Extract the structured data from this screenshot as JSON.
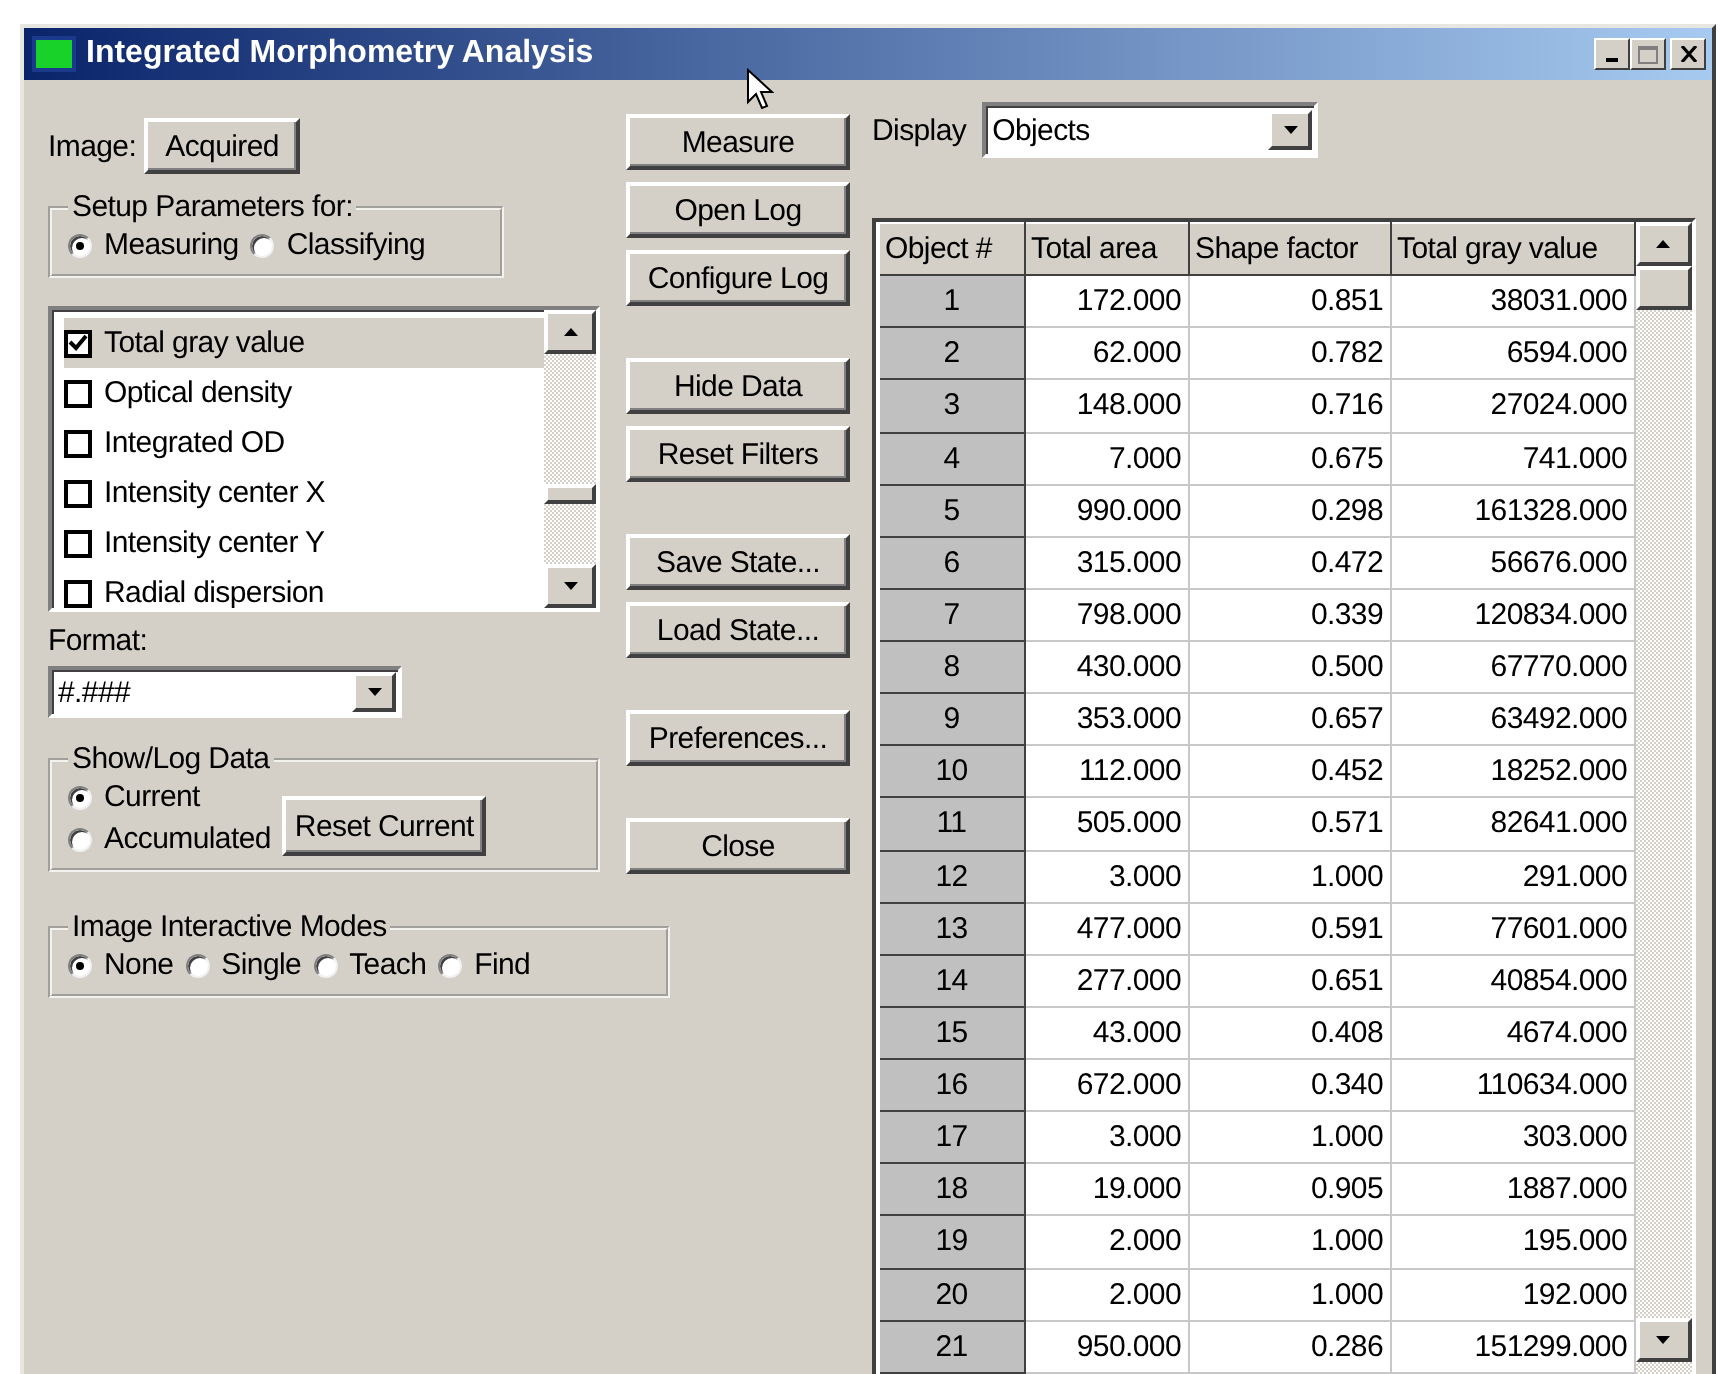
{
  "window": {
    "title": "Integrated Morphometry Analysis"
  },
  "image": {
    "label": "Image:",
    "button": "Acquired"
  },
  "setup_group": {
    "title": "Setup Parameters for:",
    "options": [
      {
        "label": "Measuring",
        "selected": true
      },
      {
        "label": "Classifying",
        "selected": false
      }
    ]
  },
  "parameters": [
    {
      "label": "Total gray value",
      "checked": true,
      "selected": true
    },
    {
      "label": "Optical density",
      "checked": false,
      "selected": false
    },
    {
      "label": "Integrated OD",
      "checked": false,
      "selected": false
    },
    {
      "label": "Intensity center X",
      "checked": false,
      "selected": false
    },
    {
      "label": "Intensity center Y",
      "checked": false,
      "selected": false
    },
    {
      "label": "Radial dispersion",
      "checked": false,
      "selected": false
    }
  ],
  "format": {
    "label": "Format:",
    "value": "#.###"
  },
  "show_log_group": {
    "title": "Show/Log Data",
    "options": [
      {
        "label": "Current",
        "selected": true
      },
      {
        "label": "Accumulated",
        "selected": false
      }
    ],
    "button": "Reset Current"
  },
  "modes_group": {
    "title": "Image Interactive Modes",
    "options": [
      {
        "label": "None",
        "selected": true
      },
      {
        "label": "Single",
        "selected": false
      },
      {
        "label": "Teach",
        "selected": false
      },
      {
        "label": "Find",
        "selected": false
      }
    ]
  },
  "button_groups": [
    [
      "Measure",
      "Open Log",
      "Configure Log"
    ],
    [
      "Hide Data",
      "Reset Filters"
    ],
    [
      "Save State...",
      "Load State..."
    ],
    [
      "Preferences..."
    ],
    [
      "Close"
    ]
  ],
  "display": {
    "label": "Display",
    "value": "Objects"
  },
  "table": {
    "columns": [
      "Object #",
      "Total area",
      "Shape factor",
      "Total gray value"
    ],
    "rows": [
      [
        "1",
        "172.000",
        "0.851",
        "38031.000"
      ],
      [
        "2",
        "62.000",
        "0.782",
        "6594.000"
      ],
      [
        "3",
        "148.000",
        "0.716",
        "27024.000"
      ],
      [
        "4",
        "7.000",
        "0.675",
        "741.000"
      ],
      [
        "5",
        "990.000",
        "0.298",
        "161328.000"
      ],
      [
        "6",
        "315.000",
        "0.472",
        "56676.000"
      ],
      [
        "7",
        "798.000",
        "0.339",
        "120834.000"
      ],
      [
        "8",
        "430.000",
        "0.500",
        "67770.000"
      ],
      [
        "9",
        "353.000",
        "0.657",
        "63492.000"
      ],
      [
        "10",
        "112.000",
        "0.452",
        "18252.000"
      ],
      [
        "11",
        "505.000",
        "0.571",
        "82641.000"
      ],
      [
        "12",
        "3.000",
        "1.000",
        "291.000"
      ],
      [
        "13",
        "477.000",
        "0.591",
        "77601.000"
      ],
      [
        "14",
        "277.000",
        "0.651",
        "40854.000"
      ],
      [
        "15",
        "43.000",
        "0.408",
        "4674.000"
      ],
      [
        "16",
        "672.000",
        "0.340",
        "110634.000"
      ],
      [
        "17",
        "3.000",
        "1.000",
        "303.000"
      ],
      [
        "18",
        "19.000",
        "0.905",
        "1887.000"
      ],
      [
        "19",
        "2.000",
        "1.000",
        "195.000"
      ],
      [
        "20",
        "2.000",
        "1.000",
        "192.000"
      ],
      [
        "21",
        "950.000",
        "0.286",
        "151299.000"
      ]
    ]
  }
}
